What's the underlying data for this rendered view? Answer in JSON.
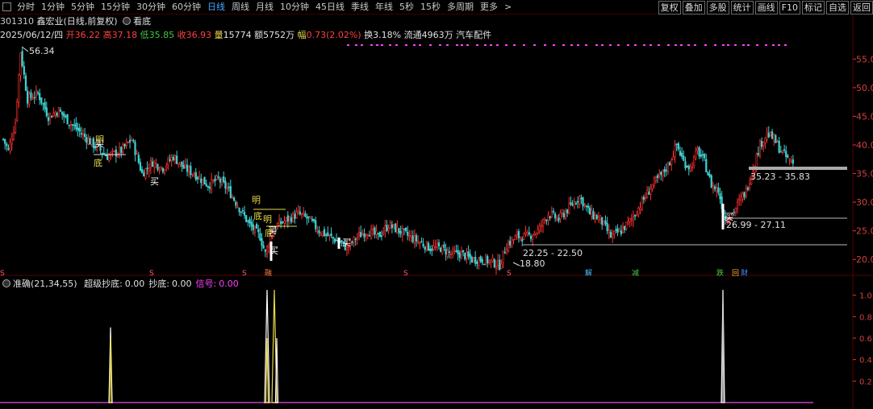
{
  "toolbar": {
    "items": [
      {
        "label": "分时",
        "active": false
      },
      {
        "label": "1分钟",
        "active": false
      },
      {
        "label": "5分钟",
        "active": false
      },
      {
        "label": "15分钟",
        "active": false
      },
      {
        "label": "30分钟",
        "active": false
      },
      {
        "label": "60分钟",
        "active": false
      },
      {
        "label": "日线",
        "active": true
      },
      {
        "label": "周线",
        "active": false
      },
      {
        "label": "月线",
        "active": false
      },
      {
        "label": "10分钟",
        "active": false
      },
      {
        "label": "45日线",
        "active": false
      },
      {
        "label": "季线",
        "active": false
      },
      {
        "label": "年线",
        "active": false
      },
      {
        "label": "5秒",
        "active": false
      },
      {
        "label": "15秒",
        "active": false
      },
      {
        "label": "多周期",
        "active": false
      },
      {
        "label": "更多",
        "active": false
      }
    ],
    "more_arrow": ">",
    "right_buttons": [
      "复权",
      "叠加",
      "多股",
      "统计",
      "画线",
      "F10",
      "标记",
      "自选",
      "返回"
    ]
  },
  "stock": {
    "code": "301310",
    "name": "鑫宏业",
    "mode": "(日线,前复权)",
    "view_label": "看底"
  },
  "quote": {
    "date": "2025/06/12/四",
    "open_label": "开",
    "open": "36.22",
    "high_label": "高",
    "high": "37.18",
    "low_label": "低",
    "low": "35.85",
    "close_label": "收",
    "close": "36.93",
    "vol_label": "量",
    "volume": "15774",
    "amount_label": "额",
    "amount": "5752万",
    "range_label": "幅",
    "range": "0.73(2.02%)",
    "turnover_label": "换",
    "turnover": "3.18%",
    "float_label": "流通",
    "float_shares": "4963万",
    "sector": "汽车配件"
  },
  "indicator": {
    "name": "准确(21,34,55)",
    "items": [
      {
        "label": "超级抄底:",
        "value": "0.00",
        "color": "#e0e0e0"
      },
      {
        "label": "抄底:",
        "value": "0.00",
        "color": "#e0e0e0"
      },
      {
        "label": "信号:",
        "value": "0.00",
        "color": "#ff40ff"
      }
    ]
  },
  "colors": {
    "up": "#ff3030",
    "down": "#40d0d0",
    "grid": "#5a0000",
    "axis": "#d04040",
    "buy_marker": "#ffffff",
    "yellow_signal": "#e8d84a",
    "magenta_dots": "#ff40ff"
  },
  "chart_data": {
    "type": "candlestick",
    "title": "",
    "y_axis": {
      "ticks": [
        "55.00",
        "50.00",
        "45.00",
        "40.00",
        "35.00",
        "30.00",
        "25.00",
        "20.00"
      ],
      "ylim": [
        17.5,
        58
      ]
    },
    "indicator_axis": {
      "ticks": [
        "1.0",
        "0.8",
        "0.6",
        "0.4",
        "0.2"
      ],
      "ylim": [
        0,
        1.05
      ]
    },
    "annotations": {
      "peak_label": "56.34",
      "low_label": "18.80",
      "range_labels": [
        "35.23 - 35.83",
        "26.99 - 27.11",
        "22.25 - 22.50"
      ],
      "buy_labels": [
        "买",
        "买",
        "买",
        "买",
        "买",
        "买"
      ],
      "bottom_labels": [
        "底",
        "底",
        "底"
      ],
      "ming_labels": [
        "明",
        "明",
        "明"
      ],
      "event_markers": [
        "S",
        "S",
        "S",
        "融",
        "S",
        "S",
        "解",
        "减",
        "跌",
        "回",
        "财"
      ]
    }
  }
}
